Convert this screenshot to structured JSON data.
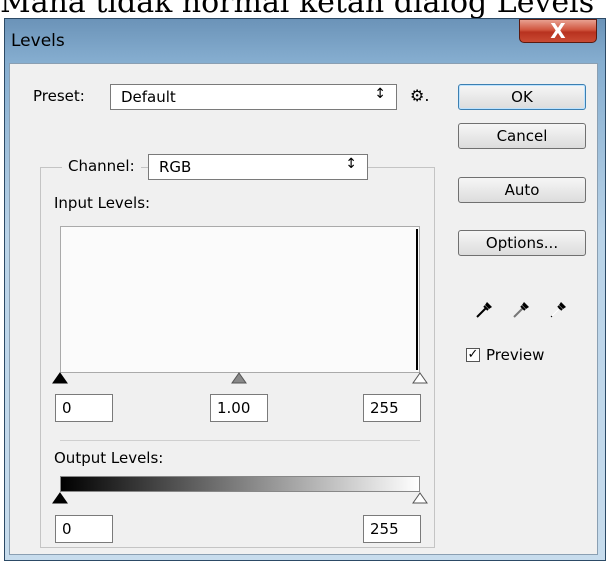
{
  "caption": {
    "text": "Mana tidak normal ketah dialog Levels"
  },
  "window": {
    "title": "Levels",
    "close_glyph": "X"
  },
  "preset": {
    "label": "Preset:",
    "value": "Default",
    "arrow": "↕",
    "gear_glyph": "⚙."
  },
  "channel": {
    "label": "Channel:",
    "value": "RGB",
    "arrow": "↕"
  },
  "input_levels": {
    "label": "Input Levels:",
    "black": "0",
    "gamma": "1.00",
    "white": "255"
  },
  "output_levels": {
    "label": "Output Levels:",
    "black": "0",
    "white": "255"
  },
  "buttons": {
    "ok": "OK",
    "cancel": "Cancel",
    "auto": "Auto",
    "options": "Options..."
  },
  "preview": {
    "label": "Preview",
    "checked": true,
    "check_glyph": "✓"
  },
  "icons": [
    "black-point-eyedropper-icon",
    "gray-point-eyedropper-icon",
    "white-point-eyedropper-icon"
  ]
}
